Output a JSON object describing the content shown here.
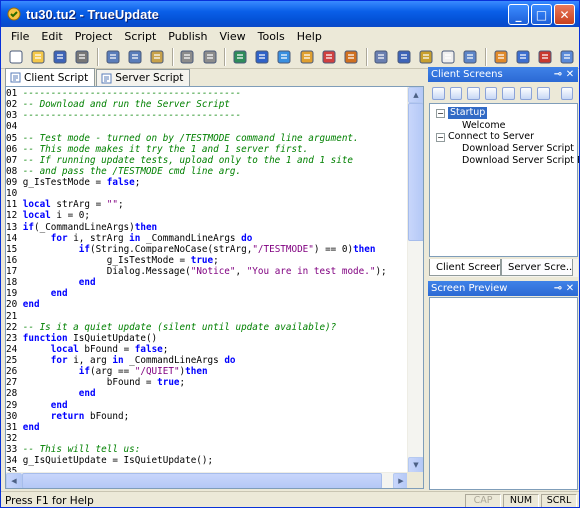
{
  "window": {
    "title": "tu30.tu2 - TrueUpdate"
  },
  "menu": [
    "File",
    "Edit",
    "Project",
    "Script",
    "Publish",
    "View",
    "Tools",
    "Help"
  ],
  "toolbar_icons": [
    "new-file-icon",
    "open-folder-icon",
    "save-icon",
    "print-icon",
    "cut-icon",
    "copy-icon",
    "paste-icon",
    "undo-icon",
    "redo-icon",
    "build-icon",
    "components-icon",
    "publish-icon",
    "checklist-icon",
    "settings-icon",
    "upload-icon",
    "preview-icon",
    "script-icon",
    "wand-icon",
    "document-icon",
    "list-dropdown-icon",
    "arrow-icon",
    "help-icon",
    "info-icon",
    "properties-icon"
  ],
  "editor_tabs": [
    {
      "label": "Client Script",
      "active": true
    },
    {
      "label": "Server Script",
      "active": false
    }
  ],
  "code_lines": [
    [
      [
        "ln",
        "01 "
      ],
      [
        "cm",
        "---------------------------------------"
      ]
    ],
    [
      [
        "ln",
        "02 "
      ],
      [
        "cm",
        "-- Download and run the Server Script"
      ]
    ],
    [
      [
        "ln",
        "03 "
      ],
      [
        "cm",
        "---------------------------------------"
      ]
    ],
    [
      [
        "ln",
        "04 "
      ]
    ],
    [
      [
        "ln",
        "05 "
      ],
      [
        "cm",
        "-- Test mode - turned on by /TESTMODE command line argument."
      ]
    ],
    [
      [
        "ln",
        "06 "
      ],
      [
        "cm",
        "-- This mode makes it try the 1 and 1 server first."
      ]
    ],
    [
      [
        "ln",
        "07 "
      ],
      [
        "cm",
        "-- If running update tests, upload only to the 1 and 1 site"
      ]
    ],
    [
      [
        "ln",
        "08 "
      ],
      [
        "cm",
        "-- and pass the /TESTMODE cmd line arg."
      ]
    ],
    [
      [
        "ln",
        "09 "
      ],
      [
        "tx",
        "g_IsTestMode = "
      ],
      [
        "kw",
        "false"
      ],
      [
        "tx",
        ";"
      ]
    ],
    [
      [
        "ln",
        "10 "
      ]
    ],
    [
      [
        "ln",
        "11 "
      ],
      [
        "kw",
        "local"
      ],
      [
        "tx",
        " strArg = "
      ],
      [
        "st",
        "\"\""
      ],
      [
        "tx",
        ";"
      ]
    ],
    [
      [
        "ln",
        "12 "
      ],
      [
        "kw",
        "local"
      ],
      [
        "tx",
        " i = 0;"
      ]
    ],
    [
      [
        "ln",
        "13 "
      ],
      [
        "kw",
        "if"
      ],
      [
        "tx",
        "(_CommandLineArgs)"
      ],
      [
        "kw",
        "then"
      ]
    ],
    [
      [
        "ln",
        "14 "
      ],
      [
        "tx",
        "     "
      ],
      [
        "kw",
        "for"
      ],
      [
        "tx",
        " i, strArg "
      ],
      [
        "kw",
        "in"
      ],
      [
        "tx",
        " _CommandLineArgs "
      ],
      [
        "kw",
        "do"
      ]
    ],
    [
      [
        "ln",
        "15 "
      ],
      [
        "tx",
        "          "
      ],
      [
        "kw",
        "if"
      ],
      [
        "tx",
        "(String.CompareNoCase(strArg,"
      ],
      [
        "st",
        "\"/TESTMODE\""
      ],
      [
        "tx",
        ") == 0)"
      ],
      [
        "kw",
        "then"
      ]
    ],
    [
      [
        "ln",
        "16 "
      ],
      [
        "tx",
        "               g_IsTestMode = "
      ],
      [
        "kw",
        "true"
      ],
      [
        "tx",
        ";"
      ]
    ],
    [
      [
        "ln",
        "17 "
      ],
      [
        "tx",
        "               Dialog.Message("
      ],
      [
        "st",
        "\"Notice\""
      ],
      [
        "tx",
        ", "
      ],
      [
        "st",
        "\"You are in test mode.\""
      ],
      [
        "tx",
        ");"
      ]
    ],
    [
      [
        "ln",
        "18 "
      ],
      [
        "tx",
        "          "
      ],
      [
        "kw",
        "end"
      ]
    ],
    [
      [
        "ln",
        "19 "
      ],
      [
        "tx",
        "     "
      ],
      [
        "kw",
        "end"
      ]
    ],
    [
      [
        "ln",
        "20 "
      ],
      [
        "kw",
        "end"
      ]
    ],
    [
      [
        "ln",
        "21 "
      ]
    ],
    [
      [
        "ln",
        "22 "
      ],
      [
        "cm",
        "-- Is it a quiet update (silent until update available)?"
      ]
    ],
    [
      [
        "ln",
        "23 "
      ],
      [
        "kw",
        "function"
      ],
      [
        "tx",
        " IsQuietUpdate()"
      ]
    ],
    [
      [
        "ln",
        "24 "
      ],
      [
        "tx",
        "     "
      ],
      [
        "kw",
        "local"
      ],
      [
        "tx",
        " bFound = "
      ],
      [
        "kw",
        "false"
      ],
      [
        "tx",
        ";"
      ]
    ],
    [
      [
        "ln",
        "25 "
      ],
      [
        "tx",
        "     "
      ],
      [
        "kw",
        "for"
      ],
      [
        "tx",
        " i, arg "
      ],
      [
        "kw",
        "in"
      ],
      [
        "tx",
        " _CommandLineArgs "
      ],
      [
        "kw",
        "do"
      ]
    ],
    [
      [
        "ln",
        "26 "
      ],
      [
        "tx",
        "          "
      ],
      [
        "kw",
        "if"
      ],
      [
        "tx",
        "(arg == "
      ],
      [
        "st",
        "\"/QUIET\""
      ],
      [
        "tx",
        ")"
      ],
      [
        "kw",
        "then"
      ]
    ],
    [
      [
        "ln",
        "27 "
      ],
      [
        "tx",
        "               bFound = "
      ],
      [
        "kw",
        "true"
      ],
      [
        "tx",
        ";"
      ]
    ],
    [
      [
        "ln",
        "28 "
      ],
      [
        "tx",
        "          "
      ],
      [
        "kw",
        "end"
      ]
    ],
    [
      [
        "ln",
        "29 "
      ],
      [
        "tx",
        "     "
      ],
      [
        "kw",
        "end"
      ]
    ],
    [
      [
        "ln",
        "30 "
      ],
      [
        "tx",
        "     "
      ],
      [
        "kw",
        "return"
      ],
      [
        "tx",
        " bFound;"
      ]
    ],
    [
      [
        "ln",
        "31 "
      ],
      [
        "kw",
        "end"
      ]
    ],
    [
      [
        "ln",
        "32 "
      ]
    ],
    [
      [
        "ln",
        "33 "
      ],
      [
        "cm",
        "-- This will tell us:"
      ]
    ],
    [
      [
        "ln",
        "34 "
      ],
      [
        "tx",
        "g_IsQuietUpdate = IsQuietUpdate();"
      ]
    ],
    [
      [
        "ln",
        "35 "
      ]
    ]
  ],
  "client_screens": {
    "title": "Client Screens",
    "tree": {
      "startup": "Startup",
      "welcome": "Welcome",
      "connect": "Connect to Server",
      "download": "Download Server Script",
      "download_failed": "Download Server Script Failed"
    },
    "tabs": [
      "Client Screens",
      "Server Scre..."
    ]
  },
  "screen_preview": {
    "title": "Screen Preview"
  },
  "status": {
    "message": "Press F1 for Help",
    "indicators": [
      {
        "label": "CAP",
        "on": false
      },
      {
        "label": "NUM",
        "on": true
      },
      {
        "label": "SCRL",
        "on": true
      }
    ]
  },
  "colors": {
    "titlebar": "#0A5FE8",
    "comment": "#008000",
    "keyword": "#0000FF",
    "string": "#800080",
    "selection": "#316AC5"
  }
}
